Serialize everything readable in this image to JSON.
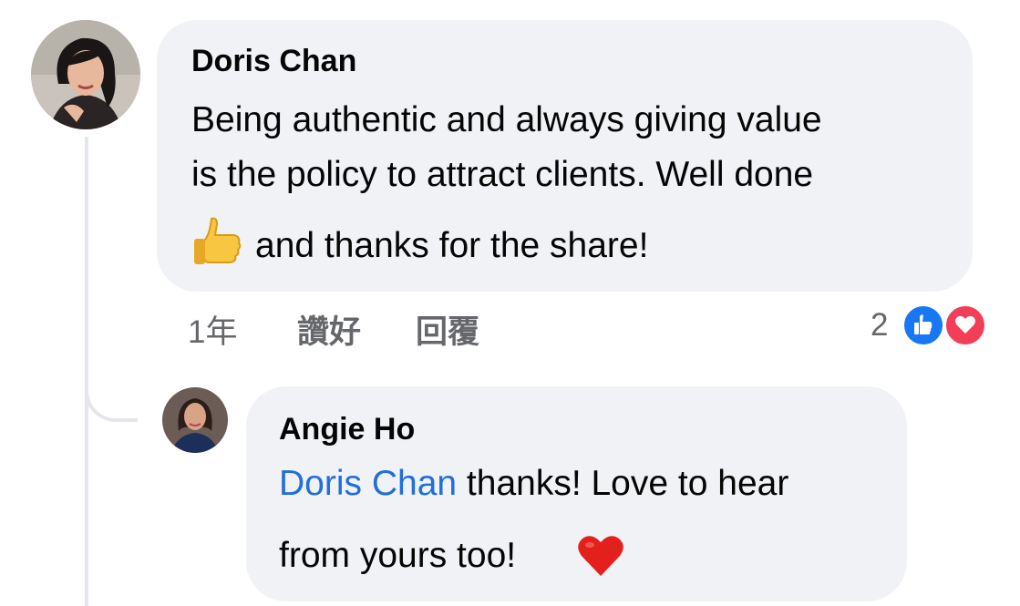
{
  "comment": {
    "author": "Doris Chan",
    "lines": [
      "Being authentic and always giving value",
      "is the policy to attract clients. Well done",
      "and thanks for the share!"
    ],
    "emoji": "thumbs-up",
    "timestamp": "1年",
    "like_label": "讚好",
    "reply_label": "回覆",
    "reaction_count": "2",
    "reactions": [
      "like-icon",
      "love-icon"
    ]
  },
  "reply": {
    "author": "Angie Ho",
    "mention": "Doris Chan",
    "line1_rest": " thanks! Love to hear",
    "line2": "from yours too!",
    "emoji": "red-heart"
  },
  "colors": {
    "bubble": "#f0f2f5",
    "mention": "#216fdb",
    "meta_text": "#65676b",
    "like_blue": "#1877f2",
    "love_red": "#f33e58"
  }
}
